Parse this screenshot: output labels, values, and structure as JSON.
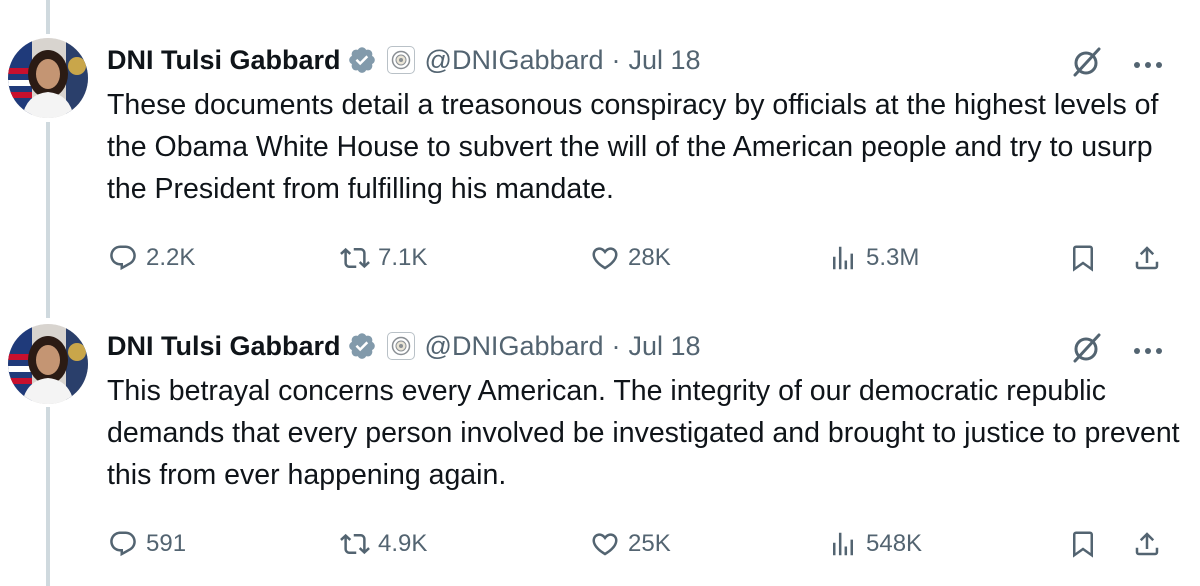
{
  "tweets": [
    {
      "author_name": "DNI Tulsi Gabbard",
      "handle": "@DNIGabbard",
      "separator": "·",
      "date": "Jul 18",
      "text": "These documents detail a treasonous conspiracy by officials at the highest levels of the Obama White House to subvert the will of the American people and try to usurp the President from fulfilling his mandate.",
      "replies": "2.2K",
      "reposts": "7.1K",
      "likes": "28K",
      "views": "5.3M"
    },
    {
      "author_name": "DNI Tulsi Gabbard",
      "handle": "@DNIGabbard",
      "separator": "·",
      "date": "Jul 18",
      "text": "This betrayal concerns every American. The integrity of our democratic republic demands that every person involved be investigated and brought to justice to prevent this from ever happening again.",
      "replies": "591",
      "reposts": "4.9K",
      "likes": "25K",
      "views": "548K"
    }
  ],
  "icons": {
    "reply": "reply-icon",
    "repost": "repost-icon",
    "like": "like-icon",
    "views": "views-icon",
    "bookmark": "bookmark-icon",
    "share": "share-icon",
    "verified": "verified-badge-icon",
    "affiliation": "government-seal-icon",
    "grok": "grok-icon",
    "more": "more-options-icon"
  },
  "colors": {
    "text": "#0f1419",
    "muted": "#536471",
    "verified_badge": "#829aab",
    "thread_line": "#cfd9de"
  }
}
